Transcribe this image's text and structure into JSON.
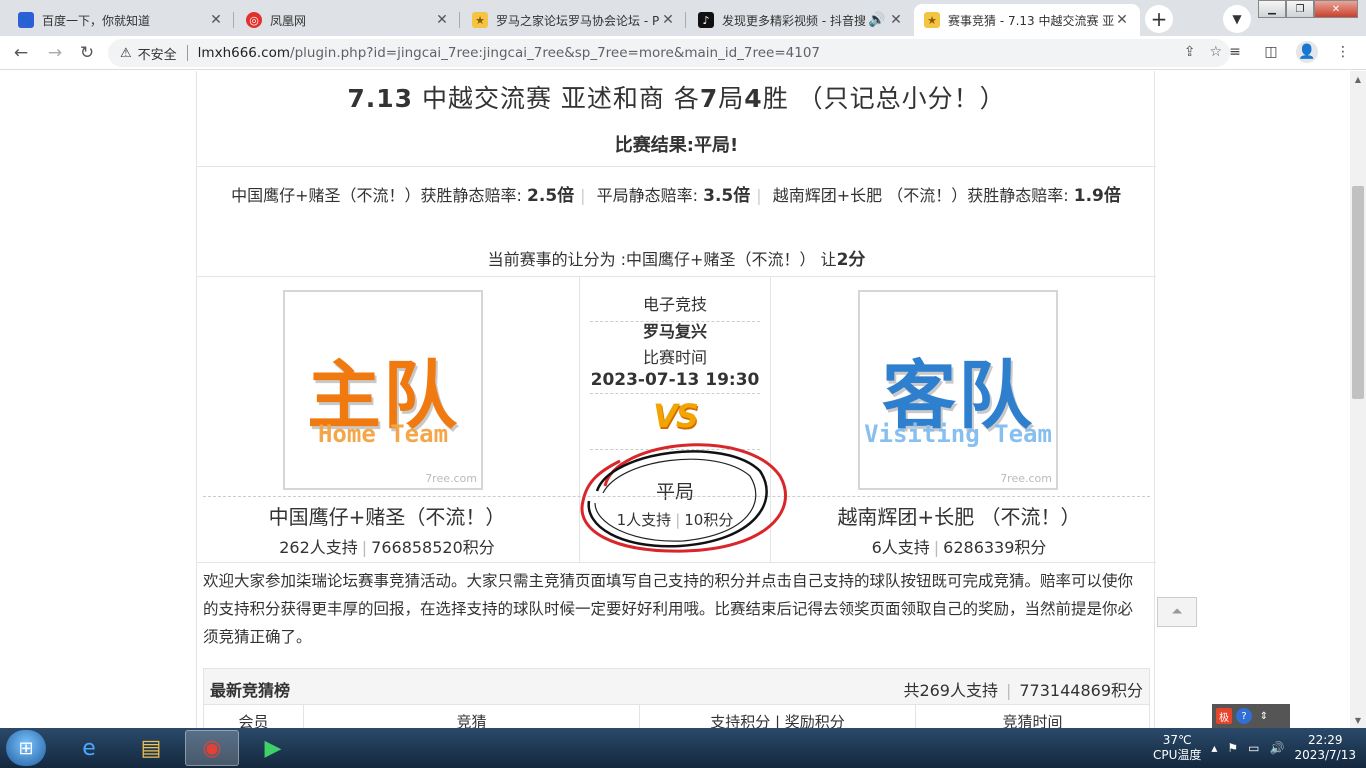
{
  "browser": {
    "tabs": [
      {
        "title": "百度一下，你就知道",
        "icon": "baidu-paw"
      },
      {
        "title": "凤凰网",
        "icon": "ifeng"
      },
      {
        "title": "罗马之家论坛罗马协会论坛 - P",
        "icon": "forum"
      },
      {
        "title": "发现更多精彩视频 - 抖音搜",
        "icon": "douyin"
      },
      {
        "title": "赛事竞猜 - 7.13 中越交流赛 亚",
        "icon": "forum"
      }
    ],
    "address": {
      "warning": "不安全",
      "host": "lmxh666.com",
      "path": "/plugin.php?id=jingcai_7ree:jingcai_7ree&sp_7ree=more&main_id_7ree=4107"
    }
  },
  "match": {
    "title_bold": "7.13",
    "title_rest": " 中越交流赛 亚述和商 各",
    "title_num1": "7",
    "title_mid": "局",
    "title_num2": "4",
    "title_end": "胜 （只记总小分！）",
    "result_label": "比赛结果:平局!",
    "odds": {
      "home_label": "中国鹰仔+赌圣（不流！）获胜静态赔率:",
      "home_value": "2.5倍",
      "draw_label": "平局静态赔率:",
      "draw_value": "3.5倍",
      "away_label": "越南辉团+长肥 （不流！）获胜静态赔率:",
      "away_value": "1.9倍"
    },
    "handicap_prefix": "当前赛事的让分为 :中国鹰仔+赌圣（不流！） 让",
    "handicap_value": "2分",
    "category": "电子竞技",
    "league": "罗马复兴",
    "time_label": "比赛时间",
    "time": "2023-07-13 19:30",
    "vs": "VS",
    "home": {
      "logo_text": "主队",
      "logo_en": "Home Team",
      "watermark": "7ree.com",
      "name": "中国鹰仔+赌圣（不流！）",
      "supporters": "262人支持",
      "points": "766858520积分"
    },
    "away": {
      "logo_text": "客队",
      "logo_en": "Visiting Team",
      "watermark": "7ree.com",
      "name": "越南辉团+长肥 （不流！）",
      "supporters": "6人支持",
      "points": "6286339积分"
    },
    "draw": {
      "label": "平局",
      "supporters": "1人支持",
      "points": "10积分"
    },
    "intro": "欢迎大家参加柒瑞论坛赛事竞猜活动。大家只需主竞猜页面填写自己支持的积分并点击自己支持的球队按钮既可完成竞猜。赔率可以使你的支持积分获得更丰厚的回报，在选择支持的球队时候一定要好好利用哦。比赛结束后记得去领奖页面领取自己的奖励，当然前提是你必须竞猜正确了。"
  },
  "board": {
    "title": "最新竞猜榜",
    "total_supporters": "共269人支持",
    "total_points": "773144869积分",
    "columns": [
      "会员",
      "竞猜",
      "支持积分 | 奖励积分",
      "竞猜时间"
    ]
  },
  "taskbar": {
    "temp": "37℃",
    "temp_label": "CPU温度",
    "time": "22:29",
    "date": "2023/7/13"
  },
  "colors": {
    "accent_circle": "#d9262b",
    "home_orange": "#f07a10",
    "away_blue": "#2f7fcf",
    "vs_gold": "#f2a400"
  }
}
